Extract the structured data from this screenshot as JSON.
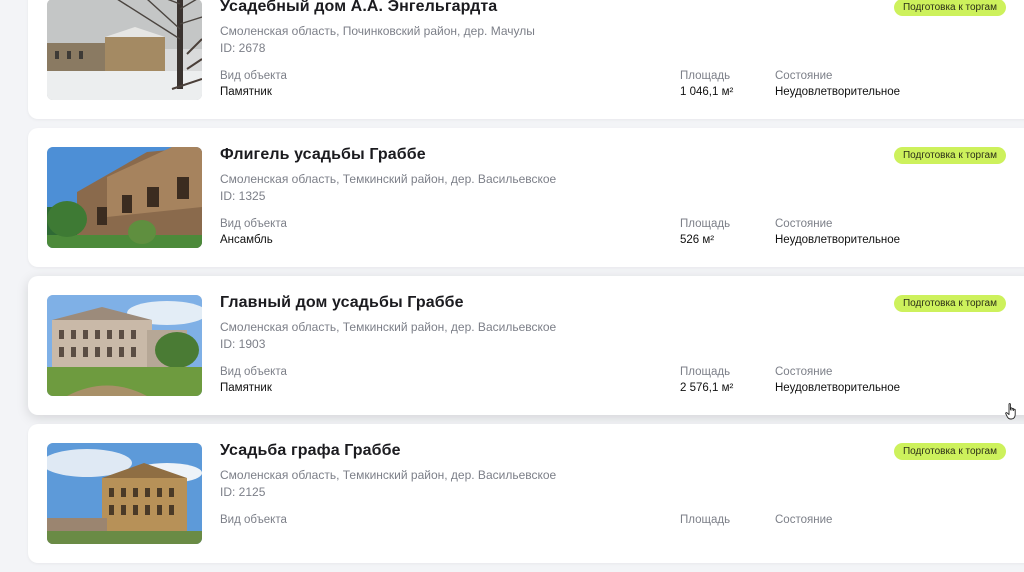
{
  "listings": [
    {
      "title": "Усадебный дом А.А. Энгельгардта",
      "address": "Смоленская область, Починковский район, дер. Мачулы",
      "id_text": "ID: 2678",
      "status": "Подготовка к торгам",
      "type_label": "Вид объекта",
      "type_value": "Памятник",
      "area_label": "Площадь",
      "area_value": "1 046,1 м²",
      "state_label": "Состояние",
      "state_value": "Неудовлетворительное"
    },
    {
      "title": "Флигель усадьбы Граббе",
      "address": "Смоленская область, Темкинский район, дер. Васильевское",
      "id_text": "ID: 1325",
      "status": "Подготовка к торгам",
      "type_label": "Вид объекта",
      "type_value": "Ансамбль",
      "area_label": "Площадь",
      "area_value": "526 м²",
      "state_label": "Состояние",
      "state_value": "Неудовлетворительное"
    },
    {
      "title": "Главный дом усадьбы Граббе",
      "address": "Смоленская область, Темкинский район, дер. Васильевское",
      "id_text": "ID: 1903",
      "status": "Подготовка к торгам",
      "type_label": "Вид объекта",
      "type_value": "Памятник",
      "area_label": "Площадь",
      "area_value": "2 576,1 м²",
      "state_label": "Состояние",
      "state_value": "Неудовлетворительное"
    },
    {
      "title": "Усадьба графа Граббе",
      "address": "Смоленская область, Темкинский район, дер. Васильевское",
      "id_text": "ID: 2125",
      "status": "Подготовка к торгам",
      "type_label": "Вид объекта",
      "type_value": "",
      "area_label": "Площадь",
      "area_value": "",
      "state_label": "Состояние",
      "state_value": ""
    }
  ],
  "colors": {
    "page_bg": "#f3f4f7",
    "card_bg": "#ffffff",
    "badge_bg": "#cdf15c",
    "muted_text": "#7c7f88"
  },
  "icons": {
    "cursor": "hand-pointer-icon"
  }
}
